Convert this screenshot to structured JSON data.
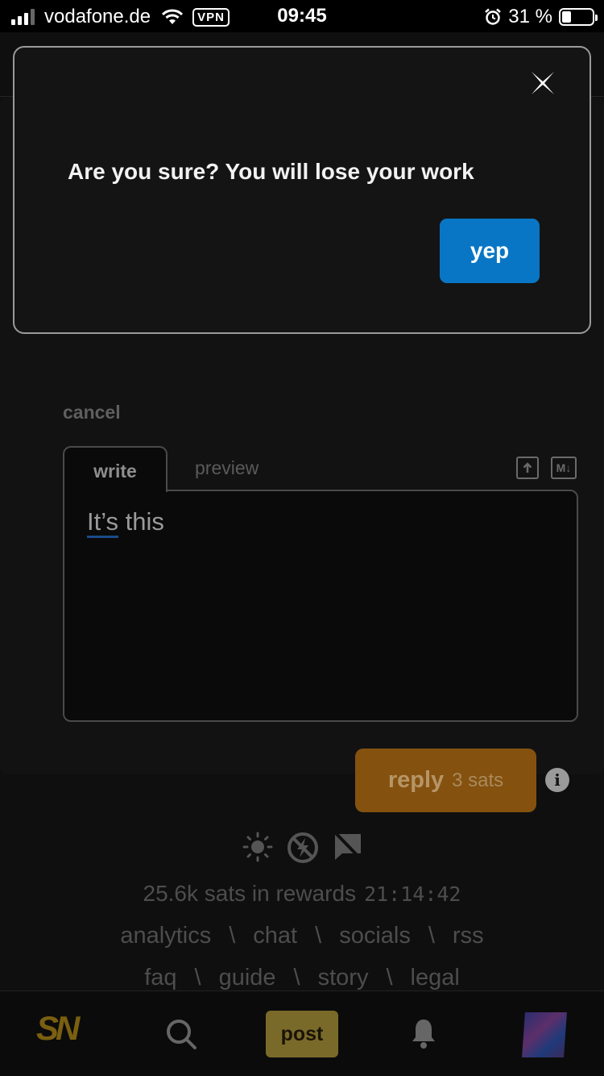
{
  "status_bar": {
    "carrier": "vodafone.de",
    "vpn": "VPN",
    "time": "09:45",
    "battery": "31 %",
    "battery_level": 0.31
  },
  "modal": {
    "message": "Are you sure? You will lose your work",
    "confirm_label": "yep",
    "close_icon": "close-icon"
  },
  "reply_form": {
    "cancel_label": "cancel",
    "tabs": [
      "write",
      "preview"
    ],
    "active_tab": "write",
    "upload_icon": "upload-icon",
    "markdown_icon": "markdown-icon",
    "markdown_icon_text": "M↓",
    "text_misspelled": "It’s",
    "text_rest": " this",
    "reply_label": "reply",
    "reply_cost": "3 sats",
    "info_icon": "info-icon"
  },
  "footer": {
    "icons": [
      "sun-icon",
      "lightning-off-icon",
      "chat-off-icon"
    ],
    "rewards_text": "25.6k sats in rewards",
    "rewards_timer": "21:14:42",
    "links_row1": [
      "analytics",
      "chat",
      "socials",
      "rss"
    ],
    "links_row2": [
      "faq",
      "guide",
      "story",
      "legal"
    ],
    "separator": "\\"
  },
  "bottom_nav": {
    "logo": "SN",
    "search_icon": "search-icon",
    "post_label": "post",
    "bell_icon": "bell-icon",
    "avatar": "avatar"
  },
  "colors": {
    "yep_button": "#0876c4",
    "reply_button": "#84510f",
    "post_button": "#7a6a2a",
    "modal_border": "#9a9a9a"
  }
}
